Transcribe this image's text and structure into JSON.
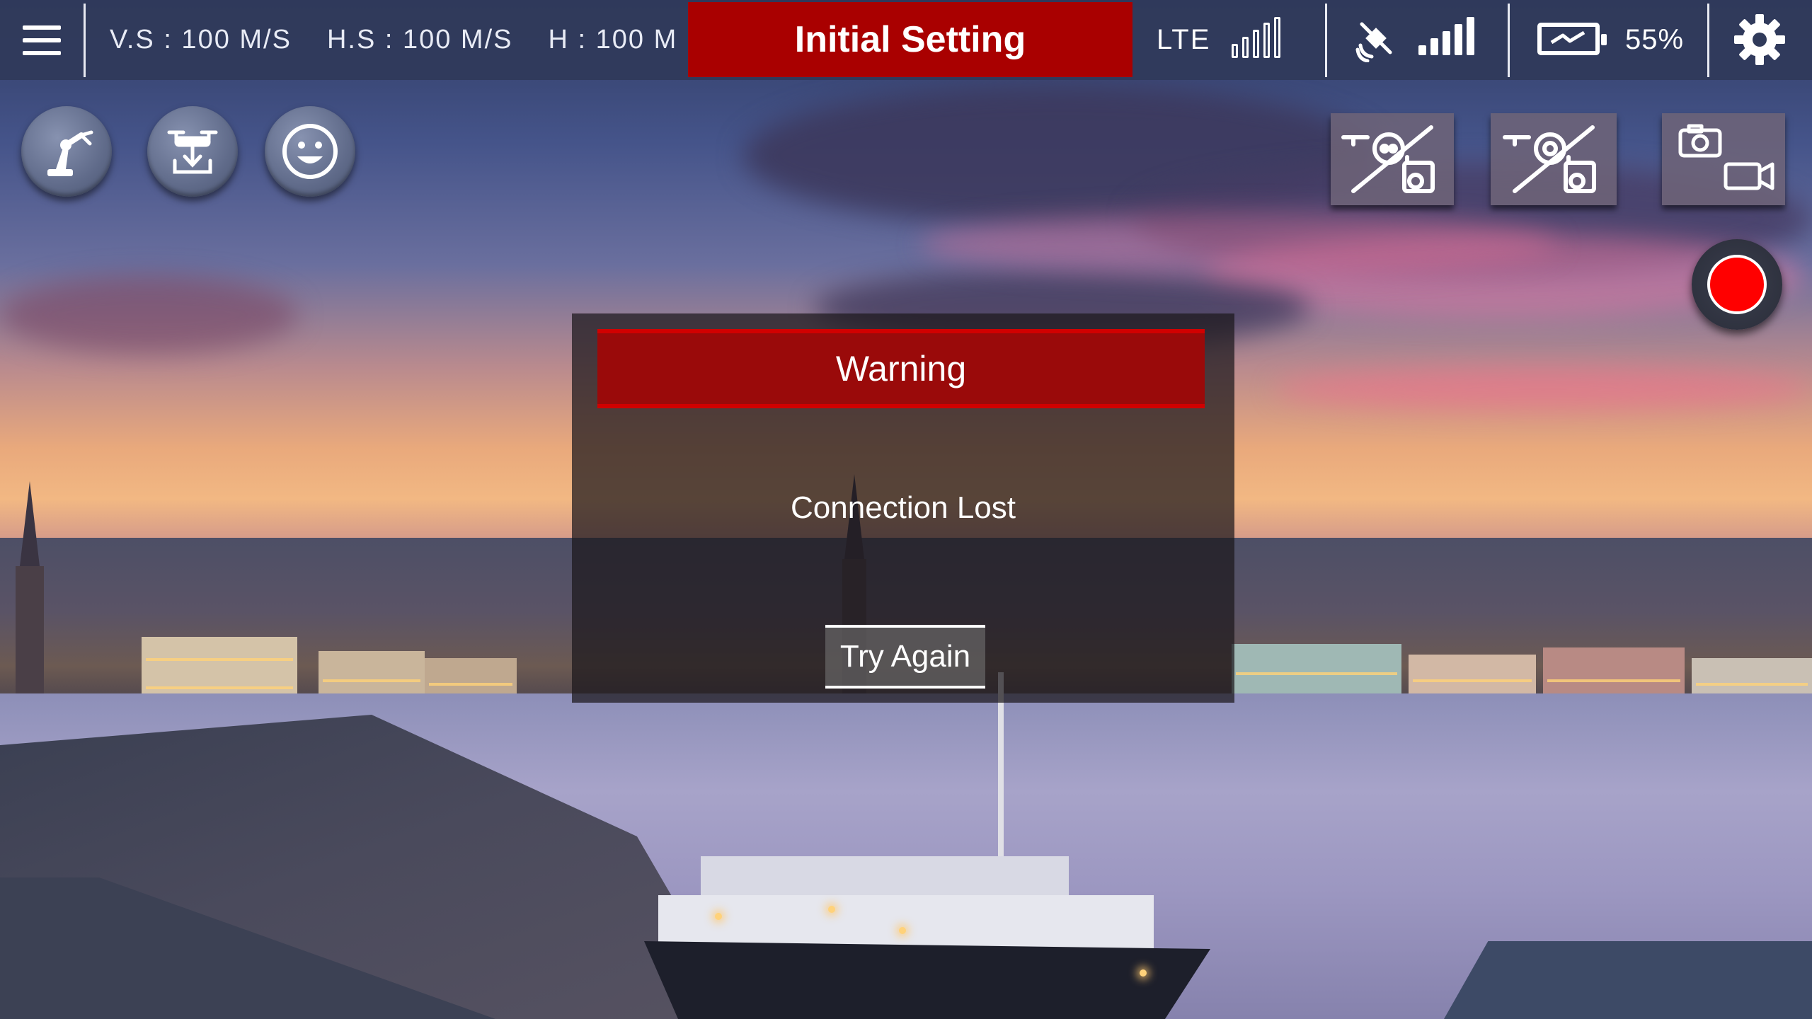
{
  "status_bar": {
    "title": "Initial Setting",
    "vertical_speed": "V.S : 100 M/S",
    "horizontal_speed": "H.S : 100 M/S",
    "height": "H : 100 M",
    "network_type": "LTE",
    "battery_percent": "55%",
    "colors": {
      "bar_bg": "#303a5a",
      "title_bg": "#a90000"
    }
  },
  "left_tools": [
    {
      "name": "robot-arm-icon"
    },
    {
      "name": "drone-land-icon"
    },
    {
      "name": "face-icon"
    }
  ],
  "right_tools": [
    {
      "name": "controller-camera-icon"
    },
    {
      "name": "drone-camera-icon"
    },
    {
      "name": "photo-video-toggle-icon"
    }
  ],
  "record": {
    "color": "#ff0000"
  },
  "dialog": {
    "title": "Warning",
    "message": "Connection Lost",
    "button_label": "Try Again"
  }
}
